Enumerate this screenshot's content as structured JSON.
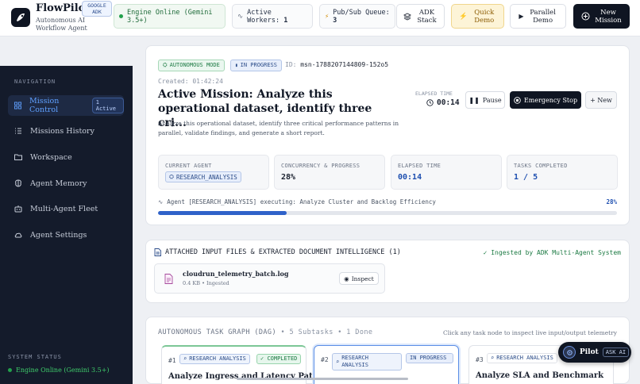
{
  "header": {
    "brand": "FlowPilot",
    "badge": "GOOGLE ADK",
    "subtitle": "Autonomous AI Workflow Agent",
    "engine_status": "Engine Online (Gemini 3.5+)",
    "workers_label": "Active Workers:",
    "workers_count": "1",
    "queue_label": "Pub/Sub Queue:",
    "queue_count": "3",
    "adk_stack": "ADK Stack",
    "quick_demo": "Quick Demo",
    "parallel_demo": "Parallel Demo",
    "new_mission": "New Mission"
  },
  "sidebar": {
    "nav_title": "NAVIGATION",
    "items": [
      {
        "label": "Mission Control",
        "badge": "1 Active",
        "icon": "dashboard-icon"
      },
      {
        "label": "Missions History",
        "icon": "list-icon"
      },
      {
        "label": "Workspace",
        "icon": "folder-icon"
      },
      {
        "label": "Agent Memory",
        "icon": "brain-icon"
      },
      {
        "label": "Multi-Agent Fleet",
        "icon": "bot-icon"
      },
      {
        "label": "Agent Settings",
        "icon": "cloud-icon"
      }
    ],
    "system_status_title": "SYSTEM STATUS",
    "system_status": "Engine Online (Gemini 3.5+)"
  },
  "mission": {
    "mode_tag": "AUTONOMOUS MODE",
    "status_tag": "IN PROGRESS",
    "id_label": "ID:",
    "id_value": "msn-1788207144809-152o5",
    "created": "Created: 01:42:24",
    "title": "Active Mission: Analyze this operational dataset, identify three cri...",
    "description": "Analyze this operational dataset, identify three critical performance patterns in parallel, validate findings, and generate a short report.",
    "elapsed_label": "ELAPSED TIME",
    "elapsed_value": "00:14",
    "pause": "Pause",
    "stop": "Emergency Stop",
    "new": "+ New",
    "stats": {
      "agent_label": "CURRENT AGENT",
      "agent_value": "RESEARCH_ANALYSIS",
      "concurrency_label": "CONCURRENCY & PROGRESS",
      "concurrency_value": "28%",
      "elapsed_label": "ELAPSED TIME",
      "elapsed_value": "00:14",
      "tasks_label": "TASKS COMPLETED",
      "tasks_value": "1 / 5"
    },
    "activity": "Agent [RESEARCH_ANALYSIS] executing: Analyze Cluster and Backlog Efficiency",
    "progress_label": "28%",
    "progress": 0.28
  },
  "files": {
    "title": "ATTACHED INPUT FILES & EXTRACTED DOCUMENT INTELLIGENCE (1)",
    "ingested": "✓ Ingested by ADK Multi-Agent System",
    "file_name": "cloudrun_telemetry_batch.log",
    "file_meta": "0.4 KB • Ingested",
    "inspect": "Inspect"
  },
  "graph": {
    "title": "AUTONOMOUS TASK GRAPH (DAG)",
    "subtitle": "• 5 Subtasks • 1 Done",
    "hint": "Click any task node to inspect live input/output telemetry",
    "nodes": [
      {
        "num": "#1",
        "agent": "RESEARCH ANALYSIS",
        "status": "COMPLETED",
        "title": "Analyze Ingress and Latency Patterns"
      },
      {
        "num": "#2",
        "agent": "RESEARCH ANALYSIS",
        "status": "IN PROGRESS",
        "title": ""
      },
      {
        "num": "#3",
        "agent": "RESEARCH ANALYSIS",
        "status": "",
        "title": "Analyze SLA and Benchmark"
      }
    ]
  },
  "pilot": {
    "label": "Pilot",
    "ask": "ASK AI"
  }
}
